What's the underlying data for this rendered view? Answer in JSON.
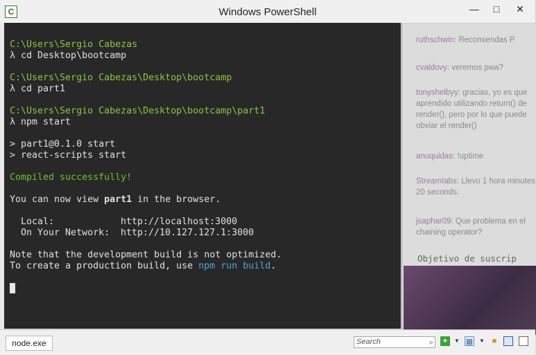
{
  "window": {
    "title": "Windows PowerShell",
    "app_icon": "C",
    "controls": {
      "minimize": "—",
      "maximize": "□",
      "close": "✕"
    }
  },
  "terminal": {
    "prompt1": "C:\\Users\\Sergio Cabezas",
    "cmd1": "λ cd Desktop\\bootcamp",
    "prompt2": "C:\\Users\\Sergio Cabezas\\Desktop\\bootcamp",
    "cmd2": "λ cd part1",
    "prompt3": "C:\\Users\\Sergio Cabezas\\Desktop\\bootcamp\\part1",
    "cmd3": "λ npm start",
    "out1": "> part1@0.1.0 start",
    "out2": "> react-scripts start",
    "compiled": "Compiled successfully!",
    "view_pre": "You can now view ",
    "view_app": "part1",
    "view_post": " in the browser.",
    "local_label": "  Local:",
    "local_url": "http://localhost:3000",
    "network_label": "  On Your Network:",
    "network_url": "http://10.127.127.1:3000",
    "note1": "Note that the development build is not optimized.",
    "note2_pre": "To create a production build, use ",
    "note2_cmd": "npm run build",
    "note2_post": "."
  },
  "statusbar": {
    "tab_label": "node.exe",
    "search_placeholder": "Search"
  },
  "background_chat": {
    "messages": [
      {
        "user": "ruthschwin",
        "text": "Recomiendas P"
      },
      {
        "user": "cvaldovy",
        "text": "veremos pwa?"
      },
      {
        "user": "tonyshelbyy",
        "text": "gracias, yo es que aprendido utilizando return() de render(), pero por lo que puede obviar el render()"
      },
      {
        "user": "anuquidas",
        "text": "!uptime"
      },
      {
        "user": "StreamIabs",
        "text": "Llevo 1 hora minutes 20 seconds."
      },
      {
        "user": "jsaphar09",
        "text": "Que problema en el chaining operator?"
      }
    ],
    "goal_text": "Objetivo de suscrip"
  },
  "colors": {
    "prompt_green": "#8cc63f",
    "success_green": "#6ec32c",
    "command_blue": "#4aa3d8",
    "terminal_bg": "#282828"
  }
}
